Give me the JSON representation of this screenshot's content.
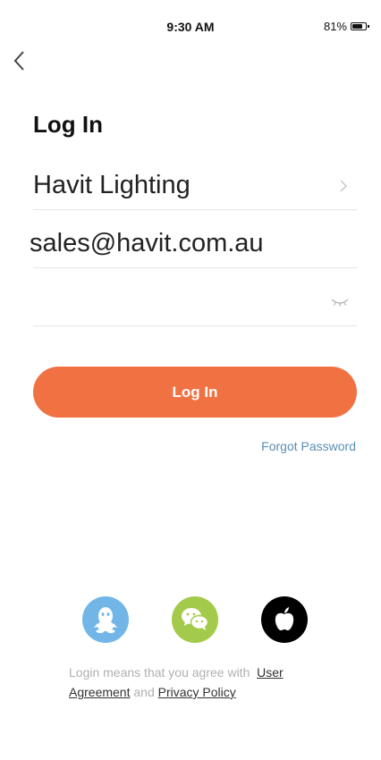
{
  "status": {
    "time": "9:30 AM",
    "battery": "81%",
    "battery_level": 0.81
  },
  "header": {
    "back_icon": "chevron-left-icon"
  },
  "title": "Log In",
  "form": {
    "region": "Havit Lighting",
    "email": "sales@havit.com.au",
    "password": ""
  },
  "login_button": "Log In",
  "forgot_password": "Forgot Password",
  "social": {
    "icons": [
      "qq-icon",
      "wechat-icon",
      "apple-icon"
    ],
    "colors": {
      "qq": "#72B6E8",
      "wechat": "#A3CA4A",
      "apple": "#000000"
    }
  },
  "agreement": {
    "prefix": "Login means that you agree with",
    "user_agreement": "User Agreement",
    "and": "and",
    "privacy_policy": "Privacy Policy"
  },
  "colors": {
    "accent": "#F07142",
    "link": "#5a8fb5"
  }
}
